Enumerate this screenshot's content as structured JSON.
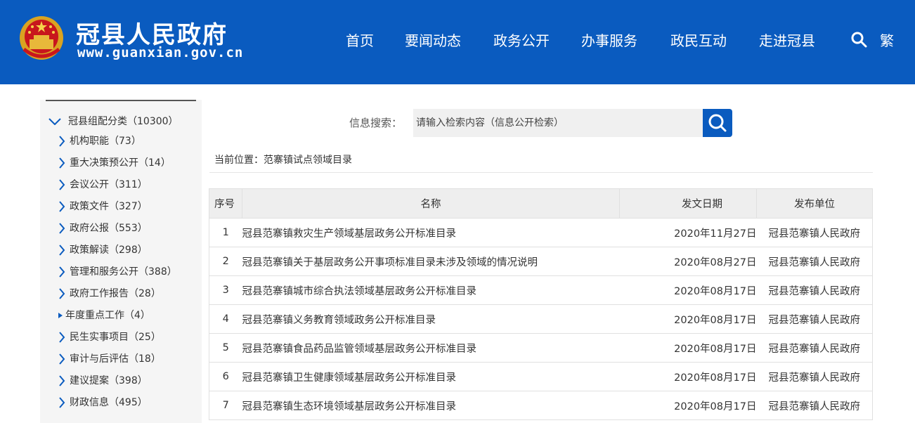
{
  "header": {
    "title": "冠县人民政府",
    "url": "www.guanxian.gov.cn",
    "nav": [
      "首页",
      "要闻动态",
      "政务公开",
      "办事服务",
      "政民互动",
      "走进冠县"
    ],
    "traditional_label": "繁",
    "bg_color": "#0a5bbf",
    "search_icon": "search-icon"
  },
  "sidebar": {
    "root_label": "冠县组配分类（10300）",
    "items": [
      "机构职能（73）",
      "重大决策预公开（14）",
      "会议公开（311）",
      "政策文件（327）",
      "政府公报（553）",
      "政策解读（298）",
      "管理和服务公开（388）",
      "政府工作报告（28）",
      "年度重点工作（4）",
      "民生实事项目（25）",
      "审计与后评估（18）",
      "建议提案（398）",
      "财政信息（495）"
    ],
    "active_index": 8
  },
  "search": {
    "label": "信息搜索：",
    "placeholder": "请输入检索内容（信息公开检索）"
  },
  "breadcrumb": "当前位置：范寨镇试点领域目录",
  "table": {
    "headers": [
      "序号",
      "名称",
      "发文日期",
      "发布单位"
    ],
    "rows": [
      [
        "1",
        "冠县范寨镇救灾生产领域基层政务公开标准目录",
        "2020年11月27日",
        "冠县范寨镇人民政府"
      ],
      [
        "2",
        "冠县范寨镇关于基层政务公开事项标准目录未涉及领域的情况说明",
        "2020年08月27日",
        "冠县范寨镇人民政府"
      ],
      [
        "3",
        "冠县范寨镇城市综合执法领域基层政务公开标准目录",
        "2020年08月17日",
        "冠县范寨镇人民政府"
      ],
      [
        "4",
        "冠县范寨镇义务教育领域政务公开标准目录",
        "2020年08月17日",
        "冠县范寨镇人民政府"
      ],
      [
        "5",
        "冠县范寨镇食品药品监管领域基层政务公开标准目录",
        "2020年08月17日",
        "冠县范寨镇人民政府"
      ],
      [
        "6",
        "冠县范寨镇卫生健康领域基层政务公开标准目录",
        "2020年08月17日",
        "冠县范寨镇人民政府"
      ],
      [
        "7",
        "冠县范寨镇生态环境领域基层政务公开标准目录",
        "2020年08月17日",
        "冠县范寨镇人民政府"
      ]
    ]
  }
}
